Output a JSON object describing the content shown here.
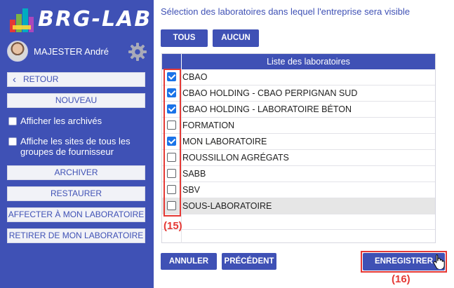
{
  "sidebar": {
    "logo_text": "BRG-LAB",
    "user_name": "MAJESTER André",
    "back_label": "RETOUR",
    "new_label": "NOUVEAU",
    "show_archived_label": "Afficher les archivés",
    "show_all_sites_label": "Affiche les sites de tous les groupes de fournisseur",
    "archive_label": "ARCHIVER",
    "restore_label": "RESTAURER",
    "assign_label": "AFFECTER À MON LABORATOIRE",
    "remove_label": "RETIRER DE MON LABORATOIRE"
  },
  "main": {
    "heading": "Sélection des laboratoires dans lequel l'entreprise sera visible",
    "all_label": "TOUS",
    "none_label": "AUCUN",
    "table_header": "Liste des laboratoires",
    "rows": [
      {
        "label": "CBAO",
        "checked": true
      },
      {
        "label": "CBAO HOLDING - CBAO PERPIGNAN SUD",
        "checked": true
      },
      {
        "label": "CBAO HOLDING - LABORATOIRE BÉTON",
        "checked": true
      },
      {
        "label": "FORMATION",
        "checked": false
      },
      {
        "label": "MON LABORATOIRE",
        "checked": true
      },
      {
        "label": "ROUSSILLON AGRÉGATS",
        "checked": false
      },
      {
        "label": "SABB",
        "checked": false
      },
      {
        "label": "SBV",
        "checked": false
      },
      {
        "label": "SOUS-LABORATOIRE",
        "checked": false
      }
    ],
    "callout_checkboxes": "(15)",
    "callout_save": "(16)",
    "cancel_label": "ANNULER",
    "previous_label": "PRÉCÉDENT",
    "save_label": "ENREGISTRER"
  },
  "colors": {
    "brand": "#3f51b5",
    "annotation": "#e53935",
    "checked": "#1a73e8"
  },
  "icons": [
    "logo-mark-icon",
    "gear-icon",
    "chevron-left-icon",
    "hand-pointer-icon"
  ]
}
